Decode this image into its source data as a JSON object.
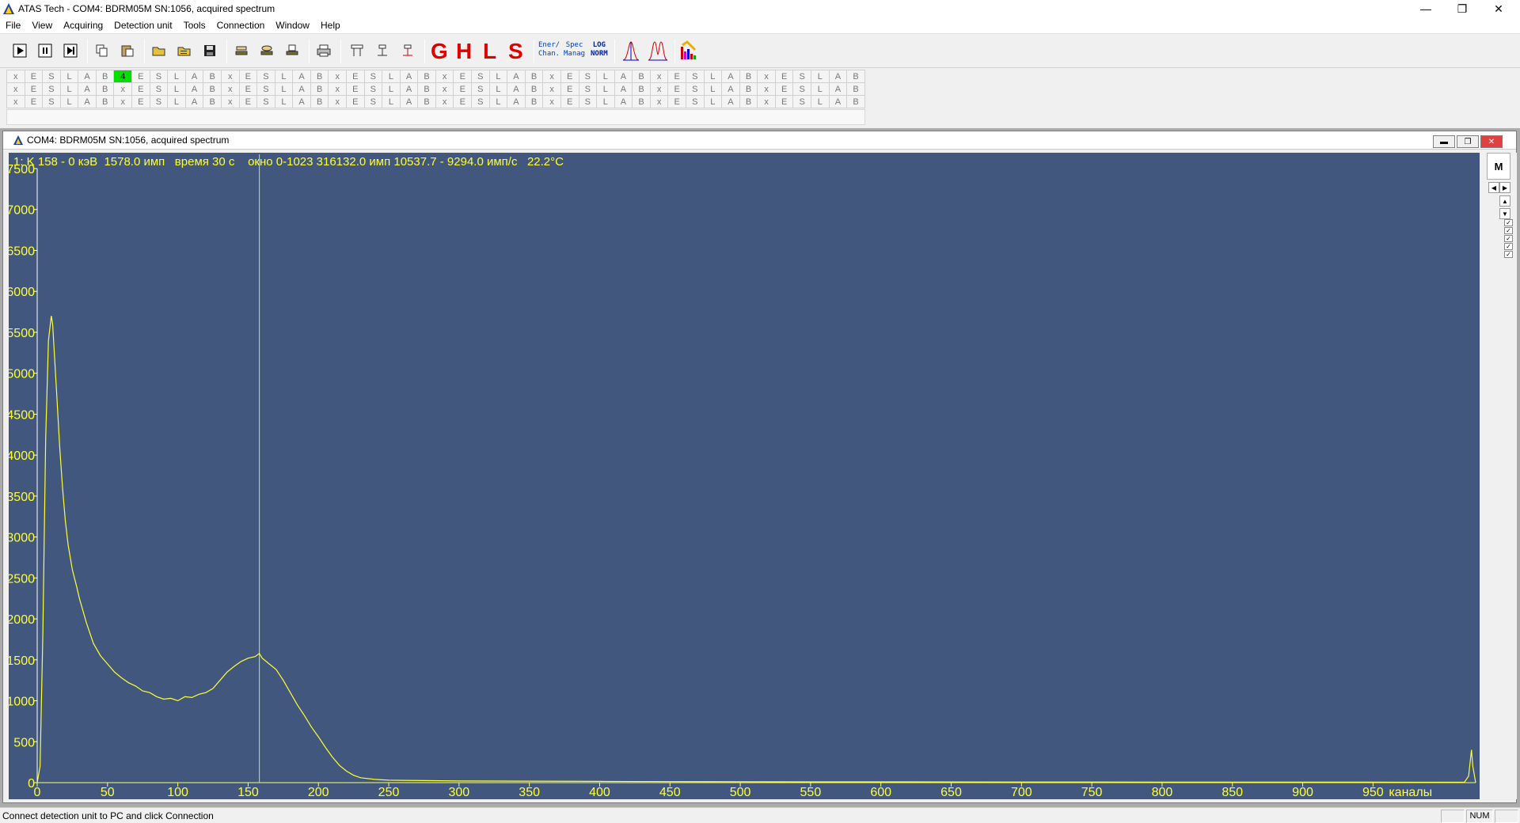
{
  "titlebar": {
    "title": "ATAS Tech  - COM4: BDRM05M SN:1056, acquired spectrum"
  },
  "menu": [
    "File",
    "View",
    "Acquiring",
    "Detection unit",
    "Tools",
    "Connection",
    "Window",
    "Help"
  ],
  "toolbar": {
    "letters": [
      "G",
      "H",
      "L",
      "S"
    ],
    "energy_label": "Ener/\nChan.",
    "spec_label": "Spec\nManag",
    "log_label": "LOG\nNORM"
  },
  "channel_grid": {
    "pattern": [
      "x",
      "E",
      "S",
      "L",
      "A",
      "B"
    ],
    "active_cell": "4"
  },
  "child": {
    "title": "COM4: BDRM05M SN:1056, acquired spectrum",
    "m_label": "M"
  },
  "info_line": "1: K 158 - 0 кэВ  1578.0 имп   время 30 с    окно 0-1023 316132.0 имп 10537.7 - 9294.0 имп/с   22.2°C",
  "status": {
    "text": "Connect detection unit to PC and click Connection",
    "num": "NUM"
  },
  "colors": {
    "plot_bg": "#41577e",
    "trace": "#ffff33",
    "axis_text": "#ffff33",
    "cursor": "#aaff33"
  },
  "chart_data": {
    "type": "line",
    "xlabel": "каналы",
    "ylabel": "",
    "xlim": [
      0,
      1023
    ],
    "ylim": [
      0,
      7500
    ],
    "x_ticks": [
      0,
      50,
      100,
      150,
      200,
      250,
      300,
      350,
      400,
      450,
      500,
      550,
      600,
      650,
      700,
      750,
      800,
      850,
      900,
      950
    ],
    "y_ticks": [
      0,
      500,
      1000,
      1500,
      2000,
      2500,
      3000,
      3500,
      4000,
      4500,
      5000,
      5500,
      6000,
      6500,
      7000,
      7500
    ],
    "cursor_channel": 158,
    "series": [
      {
        "x": [
          0,
          2,
          4,
          6,
          8,
          10,
          11,
          12,
          14,
          16,
          18,
          20,
          22,
          25,
          28,
          30,
          35,
          40,
          45,
          50,
          55,
          60,
          65,
          70,
          75,
          80,
          85,
          90,
          95,
          100,
          105,
          110,
          115,
          120,
          125,
          130,
          135,
          140,
          145,
          150,
          155,
          158,
          160,
          165,
          170,
          175,
          180,
          185,
          190,
          195,
          200,
          205,
          210,
          215,
          220,
          225,
          230,
          240,
          250,
          275,
          300,
          350,
          400,
          450,
          500,
          550,
          600,
          650,
          700,
          750,
          800,
          850,
          900,
          950,
          1000,
          1015,
          1018,
          1020,
          1021,
          1023
        ],
        "values": [
          0,
          200,
          1800,
          4200,
          5400,
          5700,
          5600,
          5300,
          4700,
          4100,
          3600,
          3200,
          2900,
          2600,
          2400,
          2250,
          1950,
          1700,
          1550,
          1450,
          1350,
          1280,
          1220,
          1180,
          1120,
          1100,
          1050,
          1020,
          1030,
          1000,
          1050,
          1040,
          1080,
          1100,
          1150,
          1250,
          1350,
          1420,
          1480,
          1520,
          1540,
          1578,
          1520,
          1450,
          1380,
          1250,
          1100,
          950,
          820,
          680,
          560,
          430,
          310,
          210,
          140,
          90,
          60,
          40,
          30,
          25,
          20,
          18,
          15,
          13,
          12,
          10,
          10,
          9,
          8,
          8,
          7,
          7,
          6,
          6,
          5,
          5,
          80,
          400,
          200,
          0
        ]
      }
    ]
  }
}
